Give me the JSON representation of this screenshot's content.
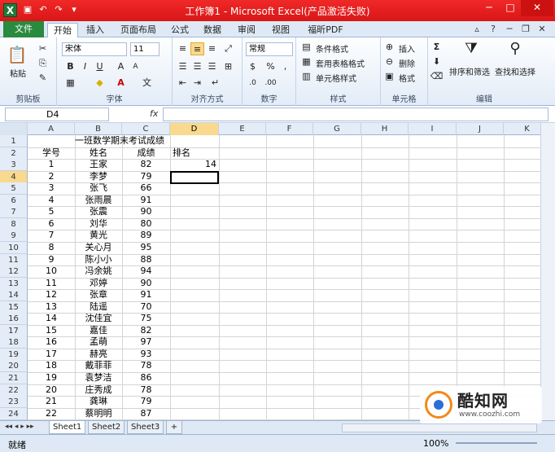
{
  "window": {
    "title": "工作簿1 - Microsoft Excel(产品激活失败)"
  },
  "tabs": [
    "文件",
    "开始",
    "插入",
    "页面布局",
    "公式",
    "数据",
    "审阅",
    "视图",
    "福昕PDF"
  ],
  "ribbon": {
    "clipboard": {
      "label": "剪贴板",
      "paste": "粘贴"
    },
    "font": {
      "label": "字体",
      "name": "宋体",
      "size": "11"
    },
    "align": {
      "label": "对齐方式"
    },
    "number": {
      "label": "数字",
      "format": "常规"
    },
    "styles": {
      "label": "样式",
      "cond": "条件格式",
      "table": "套用表格格式",
      "cell": "单元格样式"
    },
    "cells": {
      "label": "单元格",
      "insert": "插入",
      "delete": "删除",
      "format": "格式"
    },
    "editing": {
      "label": "编辑",
      "sort": "排序和筛选",
      "find": "查找和选择"
    }
  },
  "formula": {
    "namebox": "D4",
    "fx": "fx",
    "content": ""
  },
  "columns": [
    "A",
    "B",
    "C",
    "D",
    "E",
    "F",
    "G",
    "H",
    "I",
    "J",
    "K"
  ],
  "rows": [
    "1",
    "2",
    "3",
    "4",
    "5",
    "6",
    "7",
    "8",
    "9",
    "10",
    "11",
    "12",
    "13",
    "14",
    "15",
    "16",
    "17",
    "18",
    "19",
    "20",
    "21",
    "22",
    "23",
    "24"
  ],
  "sheet": {
    "title": "一班数学期末考试成绩",
    "headers": {
      "a": "学号",
      "b": "姓名",
      "c": "成绩",
      "d": "排名"
    },
    "d3": "14",
    "records": [
      {
        "id": "1",
        "name": "王家",
        "score": "82"
      },
      {
        "id": "2",
        "name": "李梦",
        "score": "79"
      },
      {
        "id": "3",
        "name": "张飞",
        "score": "66"
      },
      {
        "id": "4",
        "name": "张雨晨",
        "score": "91"
      },
      {
        "id": "5",
        "name": "张震",
        "score": "90"
      },
      {
        "id": "6",
        "name": "刘华",
        "score": "80"
      },
      {
        "id": "7",
        "name": "黄光",
        "score": "89"
      },
      {
        "id": "8",
        "name": "关心月",
        "score": "95"
      },
      {
        "id": "9",
        "name": "陈小小",
        "score": "88"
      },
      {
        "id": "10",
        "name": "冯余姚",
        "score": "94"
      },
      {
        "id": "11",
        "name": "邓婷",
        "score": "90"
      },
      {
        "id": "12",
        "name": "张章",
        "score": "91"
      },
      {
        "id": "13",
        "name": "陆遥",
        "score": "70"
      },
      {
        "id": "14",
        "name": "沈佳宜",
        "score": "75"
      },
      {
        "id": "15",
        "name": "嘉佳",
        "score": "82"
      },
      {
        "id": "16",
        "name": "孟萌",
        "score": "97"
      },
      {
        "id": "17",
        "name": "赫亮",
        "score": "93"
      },
      {
        "id": "18",
        "name": "戴菲菲",
        "score": "78"
      },
      {
        "id": "19",
        "name": "袁梦洁",
        "score": "86"
      },
      {
        "id": "20",
        "name": "庄秀成",
        "score": "78"
      },
      {
        "id": "21",
        "name": "龚琳",
        "score": "79"
      },
      {
        "id": "22",
        "name": "蔡明明",
        "score": "87"
      }
    ]
  },
  "sheet_tabs": [
    "Sheet1",
    "Sheet2",
    "Sheet3"
  ],
  "status": {
    "ready": "就绪",
    "zoom": "100%"
  },
  "watermark": {
    "title": "酷知网",
    "url": "www.coozhi.com"
  }
}
